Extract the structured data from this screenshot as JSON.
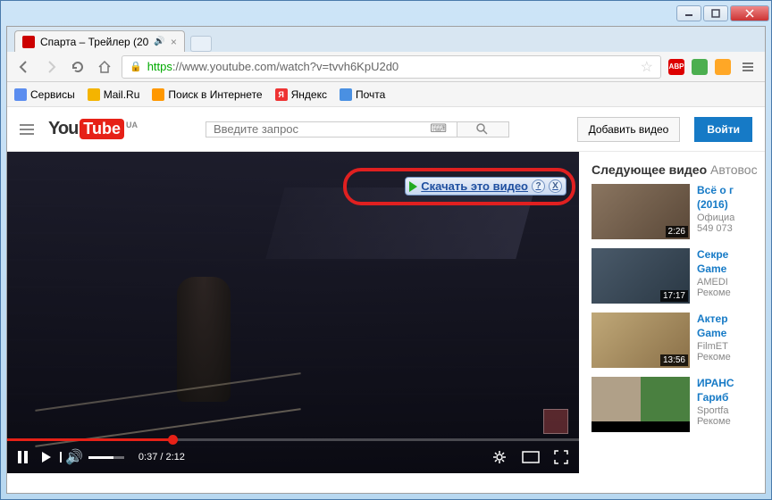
{
  "window": {
    "tab_title": "Спарта – Трейлер (20"
  },
  "browser": {
    "url_protocol": "https",
    "url_host": "://www.youtube.com",
    "url_path": "/watch?v=tvvh6KpU2d0",
    "ext_abp": "ABP"
  },
  "bookmarks": [
    {
      "label": "Сервисы",
      "color": "#5b8def"
    },
    {
      "label": "Mail.Ru",
      "color": "#f4b400"
    },
    {
      "label": "Поиск в Интернете",
      "color": "#ff9800"
    },
    {
      "label": "Яндекс",
      "color": "#555"
    },
    {
      "label": "Почта",
      "color": "#4a90e2"
    }
  ],
  "youtube": {
    "logo_you": "You",
    "logo_tube": "Tube",
    "region": "UA",
    "search_placeholder": "Введите запрос",
    "upload_label": "Добавить видео",
    "signin_label": "Войти"
  },
  "download_overlay": {
    "label": "Скачать это видео",
    "help": "?",
    "close": "X"
  },
  "player": {
    "current_time": "0:37",
    "duration": "2:12",
    "time_display": "0:37 / 2:12"
  },
  "sidebar": {
    "upnext": "Следующее видео",
    "autoplay": "Автовос",
    "items": [
      {
        "title": "Всё о г",
        "line2": "(2016)",
        "channel": "Официа",
        "views": "549 073",
        "duration": "2:26"
      },
      {
        "title": "Секре",
        "line2": "Game",
        "channel": "AMEDI",
        "views": "Рекоме",
        "duration": "17:17"
      },
      {
        "title": "Актер",
        "line2": "Game",
        "channel": "FilmET",
        "views": "Рекоме",
        "duration": "13:56"
      },
      {
        "title": "ИРАНС",
        "line2": "Гариб",
        "channel": "Sportfa",
        "views": "Рекоме",
        "duration": ""
      }
    ]
  }
}
